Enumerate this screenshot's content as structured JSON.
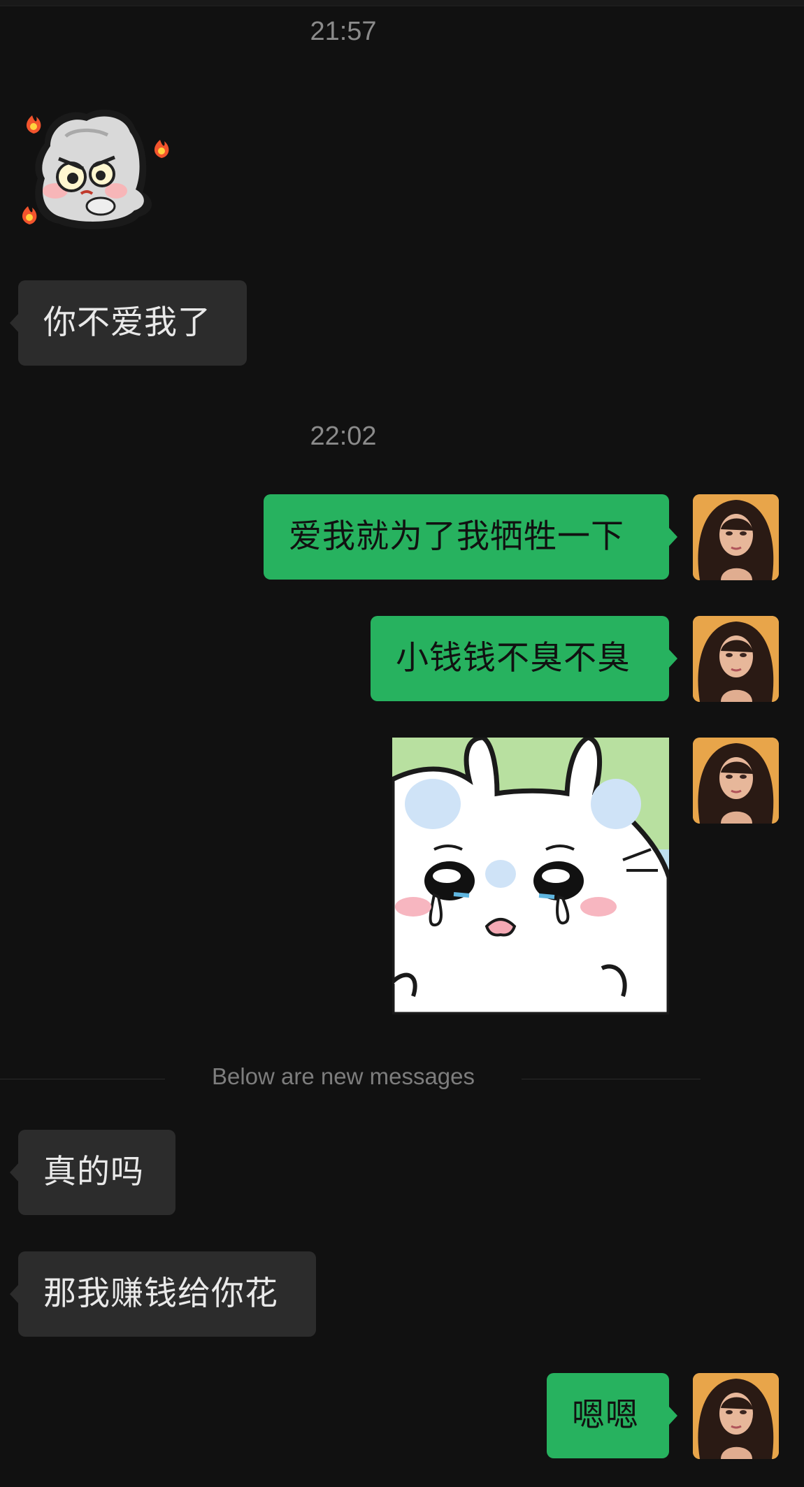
{
  "chat": {
    "timestamps": [
      "21:57",
      "22:02"
    ],
    "messages": [
      {
        "side": "left",
        "type": "sticker",
        "sticker": "angry-bunny-sticker"
      },
      {
        "side": "left",
        "type": "text",
        "text": "你不爱我了"
      },
      {
        "side": "right",
        "type": "text",
        "text": "爱我就为了我牺牲一下"
      },
      {
        "side": "right",
        "type": "text",
        "text": "小钱钱不臭不臭"
      },
      {
        "side": "right",
        "type": "sticker",
        "sticker": "crying-bunny-sticker"
      },
      {
        "side": "left",
        "type": "text",
        "text": "真的吗"
      },
      {
        "side": "left",
        "type": "text",
        "text": "那我赚钱给你花"
      },
      {
        "side": "right",
        "type": "text",
        "text": "嗯嗯"
      }
    ],
    "new_messages_divider": "Below are new messages"
  },
  "colors": {
    "background": "#111111",
    "incoming_bubble": "#2c2c2c",
    "outgoing_bubble": "#27b25f",
    "timestamp_text": "#8b8b8b"
  },
  "icons": {
    "user_avatar": "user-avatar-photo"
  }
}
